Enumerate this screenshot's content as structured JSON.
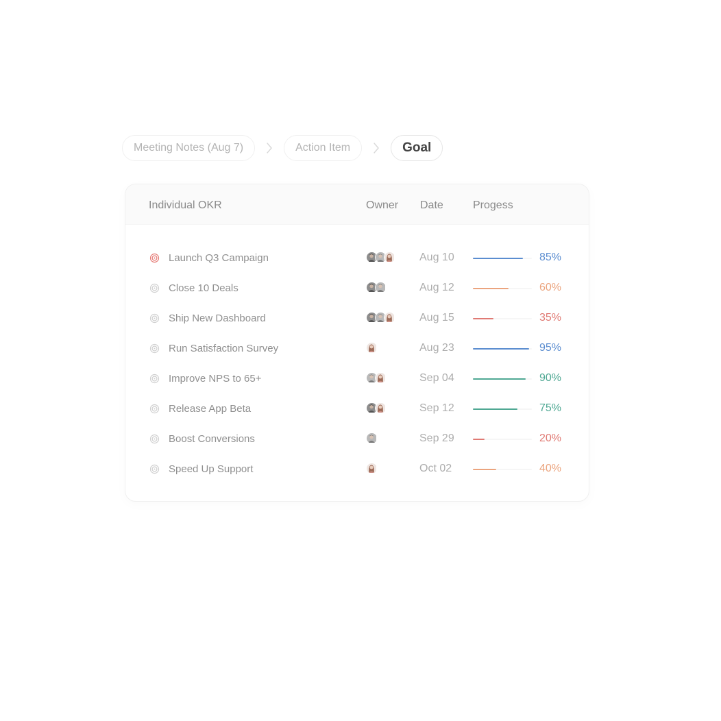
{
  "breadcrumb": {
    "items": [
      "Meeting Notes (Aug 7)",
      "Action Item",
      "Goal"
    ]
  },
  "table": {
    "headers": {
      "okr": "Individual OKR",
      "owner": "Owner",
      "date": "Date",
      "progress": "Progess"
    },
    "rows": [
      {
        "title": "Launch Q3 Campaign",
        "owners": [
          "man-dark",
          "man-light",
          "woman"
        ],
        "date": "Aug 10",
        "progress": 85,
        "progress_label": "85%",
        "color": "#5b8dd0",
        "active": true
      },
      {
        "title": "Close 10 Deals",
        "owners": [
          "man-dark",
          "man-light"
        ],
        "date": "Aug 12",
        "progress": 60,
        "progress_label": "60%",
        "color": "#eba47e",
        "active": false
      },
      {
        "title": "Ship New Dashboard",
        "owners": [
          "man-dark",
          "man-light",
          "woman"
        ],
        "date": "Aug 15",
        "progress": 35,
        "progress_label": "35%",
        "color": "#e07a74",
        "active": false
      },
      {
        "title": "Run Satisfaction Survey",
        "owners": [
          "woman"
        ],
        "date": "Aug 23",
        "progress": 95,
        "progress_label": "95%",
        "color": "#5b8dd0",
        "active": false
      },
      {
        "title": "Improve NPS to 65+",
        "owners": [
          "man-light",
          "woman"
        ],
        "date": "Sep 04",
        "progress": 90,
        "progress_label": "90%",
        "color": "#4fa893",
        "active": false
      },
      {
        "title": "Release App Beta",
        "owners": [
          "man-dark",
          "woman"
        ],
        "date": "Sep 12",
        "progress": 75,
        "progress_label": "75%",
        "color": "#4fa893",
        "active": false
      },
      {
        "title": "Boost Conversions",
        "owners": [
          "man-light"
        ],
        "date": "Sep 29",
        "progress": 20,
        "progress_label": "20%",
        "color": "#e07a74",
        "active": false
      },
      {
        "title": "Speed Up Support",
        "owners": [
          "woman"
        ],
        "date": "Oct 02",
        "progress": 40,
        "progress_label": "40%",
        "color": "#eba47e",
        "active": false
      }
    ]
  },
  "icons": {
    "goal": "target-icon",
    "separator": "chevron-right-icon",
    "owner": "avatar-photo"
  },
  "colors": {
    "active_goal": "#e57873",
    "inactive_goal": "#cfcfcf"
  }
}
